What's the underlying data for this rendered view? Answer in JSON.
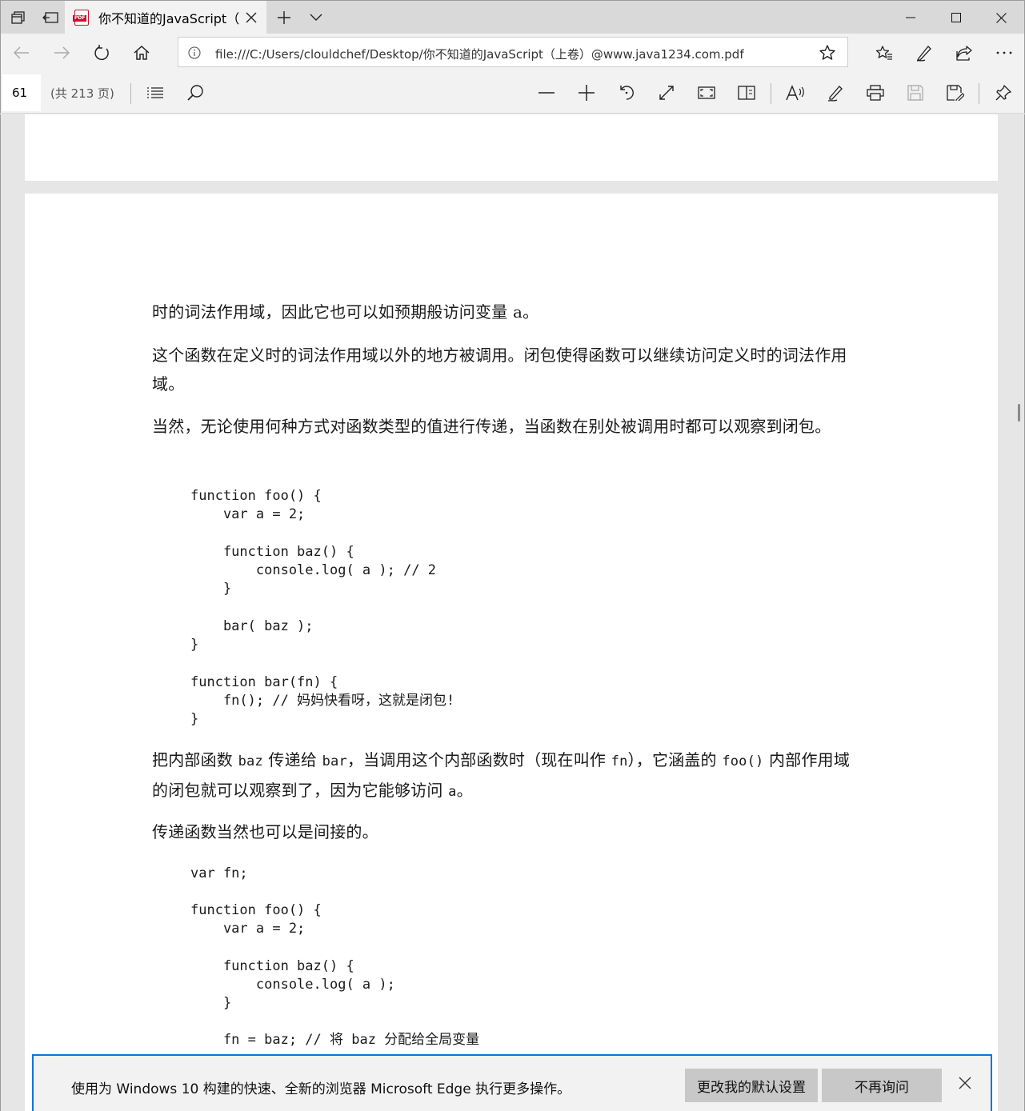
{
  "window": {
    "tab_title": "你不知道的JavaScript（",
    "pdf_badge": "PDF"
  },
  "address": {
    "url": "file:///C:/Users/clouldchef/Desktop/你不知道的JavaScript（上卷）@www.java1234.com.pdf"
  },
  "pdf_toolbar": {
    "page_number": "61",
    "page_total": "(共 213 页)"
  },
  "document": {
    "para1": "时的词法作用域，因此它也可以如预期般访问变量 a。",
    "para2": "这个函数在定义时的词法作用域以外的地方被调用。闭包使得函数可以继续访问定义时的词法作用域。",
    "para3": "当然，无论使用何种方式对函数类型的值进行传递，当函数在别处被调用时都可以观察到闭包。",
    "code1": [
      "function foo() {",
      "    var a = 2;",
      "",
      "    function baz() {",
      "        console.log( a ); // 2",
      "    }",
      "",
      "    bar( baz );",
      "}",
      "",
      "function bar(fn) {",
      "    fn(); // 妈妈快看呀，这就是闭包!",
      "}"
    ],
    "para4": {
      "t1": "把内部函数 ",
      "c1": "baz",
      "t2": " 传递给 ",
      "c2": "bar",
      "t3": "，当调用这个内部函数时（现在叫作 ",
      "c3": "fn",
      "t4": "），它涵盖的 ",
      "c4": "foo()",
      "t5": " 内部作用域的闭包就可以观察到了，因为它能够访问 ",
      "c5": "a",
      "t6": "。"
    },
    "para5": "传递函数当然也可以是间接的。",
    "code2": [
      "var fn;",
      "",
      "function foo() {",
      "    var a = 2;",
      "",
      "    function baz() {",
      "        console.log( a );",
      "    }",
      "",
      "    fn = baz; // 将 baz 分配给全局变量"
    ]
  },
  "notification": {
    "text": "使用为 Windows 10 构建的快速、全新的浏览器 Microsoft Edge 执行更多操作。",
    "change_defaults": "更改我的默认设置",
    "dont_ask": "不再询问"
  }
}
